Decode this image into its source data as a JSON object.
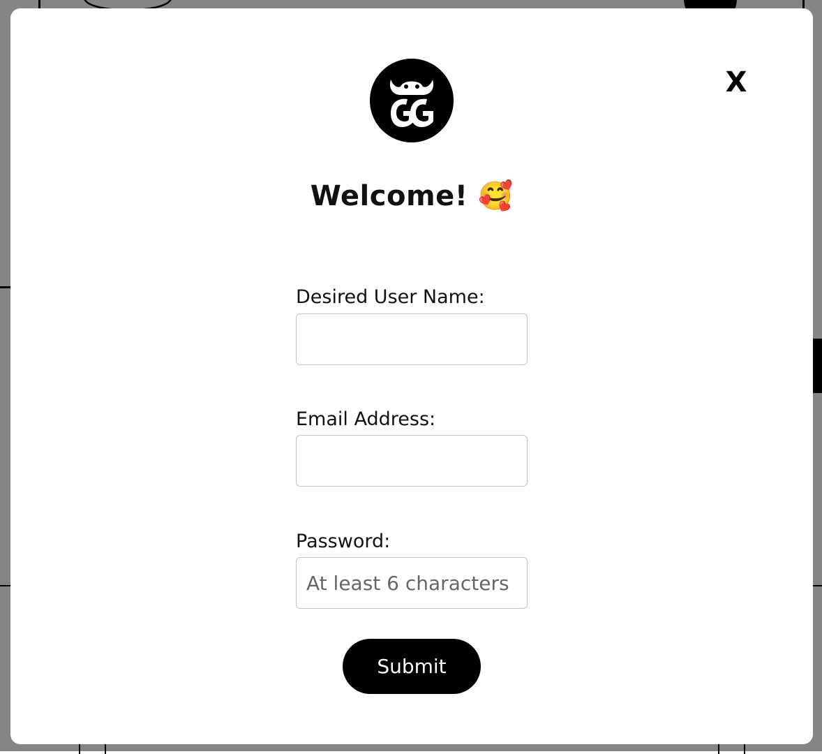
{
  "modal": {
    "close_label": "X",
    "welcome_title": "Welcome! 🥰",
    "fields": [
      {
        "label": "Desired User Name:",
        "value": "",
        "placeholder": ""
      },
      {
        "label": "Email Address:",
        "value": "",
        "placeholder": ""
      },
      {
        "label": "Password:",
        "value": "",
        "placeholder": "At least 6 characters"
      }
    ],
    "submit_label": "Submit"
  },
  "colors": {
    "overlay": "#7a7a7a",
    "modal_bg": "#ffffff",
    "button_bg": "#000000",
    "button_text": "#ffffff",
    "input_border": "#c4c4c4"
  }
}
